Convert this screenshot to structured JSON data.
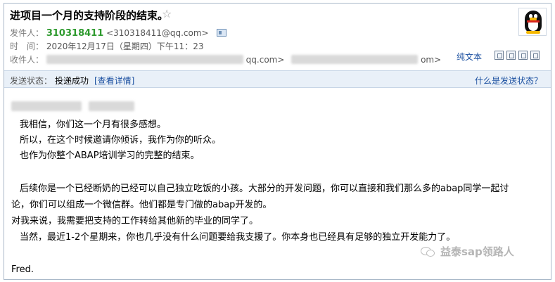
{
  "header": {
    "subject": "进项目一个月的支持阶段的结束。",
    "sender_label": "发件人：",
    "sender_name": "310318411",
    "sender_email": "<310318411@qq.com>",
    "time_label": "时　间：",
    "time_value": "2020年12月17日（星期四）下午11：23",
    "recipient_label": "收件人：",
    "recipient_suffix_1": "qq.com>",
    "recipient_suffix_2": "om>",
    "plaintext_label": "纯文本"
  },
  "status": {
    "label": "发送状态：",
    "value": "投递成功",
    "details_link": "[查看详情]",
    "help_link": "什么是发送状态？"
  },
  "body": {
    "lines": [
      "我相信，你们这一个月有很多感想。",
      "所以，在这个时候邀请你倾诉，我作为你的听众。",
      "也作为你整个ABAP培训学习的完整的结束。",
      "后续你是一个已经断奶的已经可以自己独立吃饭的小孩。大部分的开发问题，你可以直接和我们那么多的abap同学一起讨",
      "论，你们可以组成一个微信群。他们都是专门做的abap开发的。",
      "对我来说，我需要把支持的工作转给其他新的毕业的同学了。",
      "当然，最近1-2个星期来，你也几乎没有什么问题要给我支援了。你本身也已经具有足够的独立开发能力了。",
      "Fred."
    ]
  },
  "watermark": {
    "text": "益泰sap领路人"
  },
  "icons": [
    "star-icon",
    "vcard-icon",
    "qq-penguin-icon",
    "toolbar-icons",
    "wechat-icon"
  ]
}
